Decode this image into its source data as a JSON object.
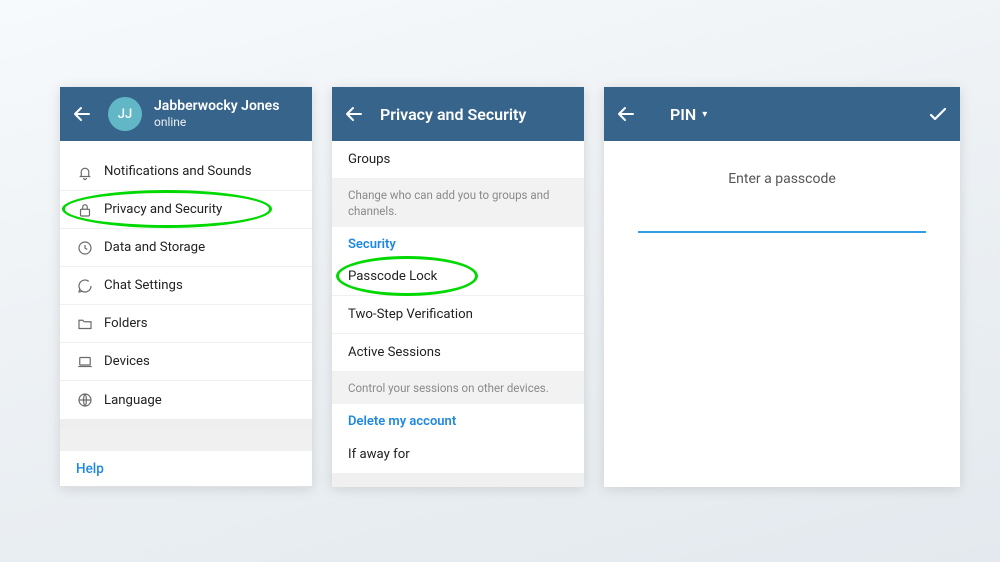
{
  "colors": {
    "header": "#36648b",
    "accent": "#1e88e5",
    "highlight": "#00d900"
  },
  "screen1": {
    "back": true,
    "avatar_initials": "JJ",
    "user_name": "Jabberwocky Jones",
    "user_status": "online",
    "settings": [
      {
        "icon": "bell-icon",
        "label": "Notifications and Sounds"
      },
      {
        "icon": "lock-icon",
        "label": "Privacy and Security"
      },
      {
        "icon": "clock-icon",
        "label": "Data and Storage"
      },
      {
        "icon": "chat-icon",
        "label": "Chat Settings"
      },
      {
        "icon": "folder-icon",
        "label": "Folders"
      },
      {
        "icon": "laptop-icon",
        "label": "Devices"
      },
      {
        "icon": "globe-icon",
        "label": "Language"
      }
    ],
    "help_label": "Help",
    "highlighted_index": 1
  },
  "screen2": {
    "title": "Privacy and Security",
    "top_item": "Groups",
    "top_hint": "Change who can add you to groups and channels.",
    "sections": [
      {
        "title": "Security",
        "items": [
          "Passcode Lock",
          "Two-Step Verification",
          "Active Sessions"
        ],
        "hint": "Control your sessions on other devices.",
        "highlighted_index": 0
      },
      {
        "title": "Delete my account",
        "items": [
          "If away for"
        ]
      }
    ]
  },
  "screen3": {
    "mode_label": "PIN",
    "instruction": "Enter a passcode",
    "input_value": ""
  }
}
